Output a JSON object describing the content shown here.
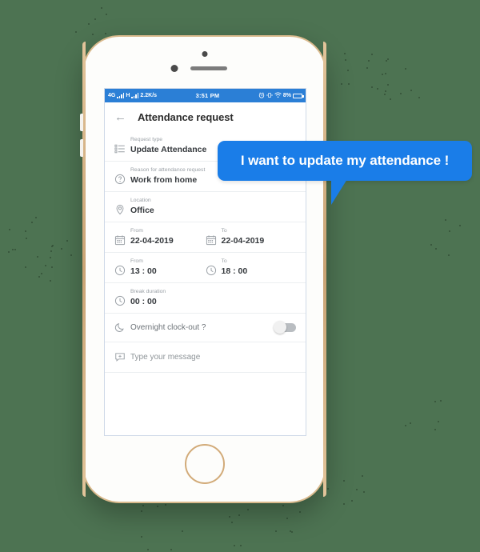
{
  "background": {
    "color": "#4d7352"
  },
  "speech_bubble": {
    "text": "I want to update my attendance !",
    "color": "#1a7de8"
  },
  "phone": {
    "statusbar": {
      "network": "4G",
      "network2": "H",
      "speed": "2.2K/s",
      "time": "3:51 PM",
      "battery": "8%",
      "icons": [
        "signal-bars-icon",
        "hspa-signal-icon",
        "alarm-clock-icon",
        "vibrate-icon",
        "wifi-icon",
        "battery-icon"
      ],
      "color": "#2b7fd6"
    },
    "appbar": {
      "back": "←",
      "title": "Attendance request"
    },
    "form": {
      "request_type": {
        "label": "Request type",
        "value": "Update Attendance",
        "icon": "list-icon"
      },
      "reason": {
        "label": "Reason for attendance request",
        "value": "Work from home",
        "icon": "question-circle-icon"
      },
      "location": {
        "label": "Location",
        "value": "Office",
        "icon": "map-pin-icon"
      },
      "date_from": {
        "label": "From",
        "value": "22-04-2019",
        "icon": "calendar-icon"
      },
      "date_to": {
        "label": "To",
        "value": "22-04-2019",
        "icon": "calendar-icon"
      },
      "time_from": {
        "label": "From",
        "value": "13 : 00",
        "icon": "clock-icon"
      },
      "time_to": {
        "label": "To",
        "value": "18 : 00",
        "icon": "clock-icon"
      },
      "break_duration": {
        "label": "Break duration",
        "value": "00 : 00",
        "icon": "clock-icon"
      },
      "overnight": {
        "label": "Overnight clock-out ?",
        "icon": "moon-icon",
        "toggle_state": "off"
      },
      "message": {
        "placeholder": "Type your message",
        "icon": "chat-bubble-icon"
      }
    }
  }
}
